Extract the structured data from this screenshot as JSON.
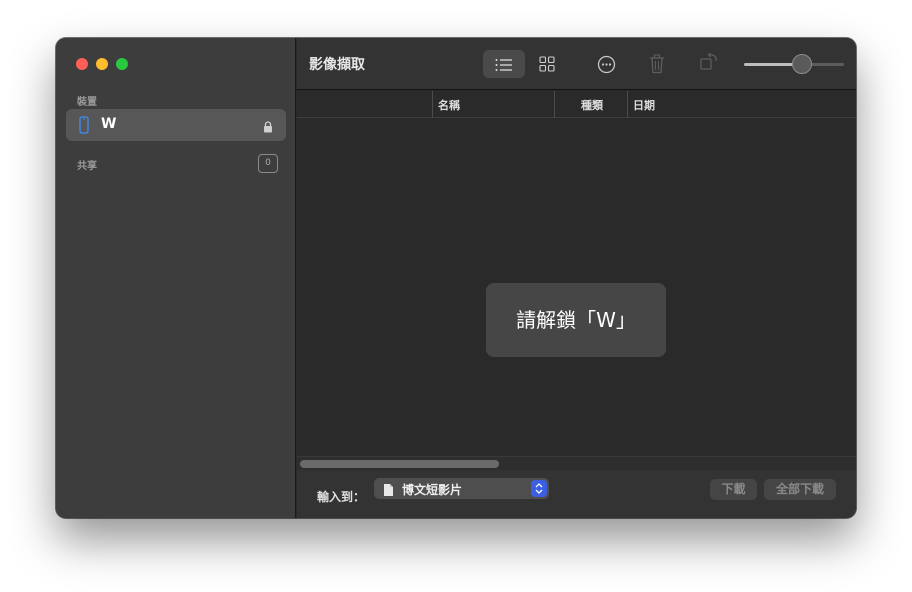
{
  "window": {
    "title": "影像擷取"
  },
  "sidebar": {
    "devices_heading": "裝置",
    "device_name": "W",
    "shared_heading": "共享",
    "shared_count": "0"
  },
  "toolbar": {
    "icons": [
      "list-view-icon",
      "grid-view-icon",
      "more-icon",
      "trash-icon",
      "rotate-icon"
    ],
    "zoom_slider_level": 0.58
  },
  "columns": {
    "name": "名稱",
    "kind": "種類",
    "date": "日期"
  },
  "message": "請解鎖「W」",
  "bottom": {
    "import_label": "輸入到：",
    "destination": "博文短影片",
    "download_label": "下載",
    "download_all_label": "全部下載"
  },
  "colors": {
    "red": "#ff5f57",
    "yellow": "#febc2e",
    "green": "#28c840",
    "accent": "#3b5fe0"
  }
}
